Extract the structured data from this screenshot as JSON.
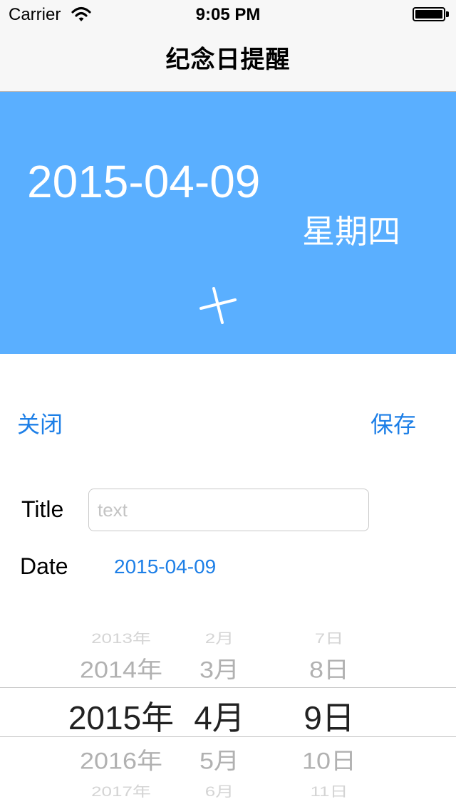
{
  "status_bar": {
    "carrier": "Carrier",
    "time": "9:05 PM",
    "icons": [
      "wifi-icon",
      "battery-icon"
    ]
  },
  "nav": {
    "title": "纪念日提醒"
  },
  "hero": {
    "date": "2015-04-09",
    "weekday": "星期四",
    "add_icon": "plus-icon",
    "background_color": "#5aafff"
  },
  "actions": {
    "close_label": "关闭",
    "save_label": "保存",
    "link_color": "#1d7fe7"
  },
  "form": {
    "title_label": "Title",
    "title_value": "",
    "title_placeholder": "text",
    "date_label": "Date",
    "date_value": "2015-04-09"
  },
  "picker": {
    "years": [
      "2013年",
      "2014年",
      "2015年",
      "2016年",
      "2017年"
    ],
    "months": [
      "2月",
      "3月",
      "4月",
      "5月",
      "6月"
    ],
    "days": [
      "7日",
      "8日",
      "9日",
      "10日",
      "11日"
    ],
    "selected": {
      "year": "2015年",
      "month": "4月",
      "day": "9日"
    }
  }
}
